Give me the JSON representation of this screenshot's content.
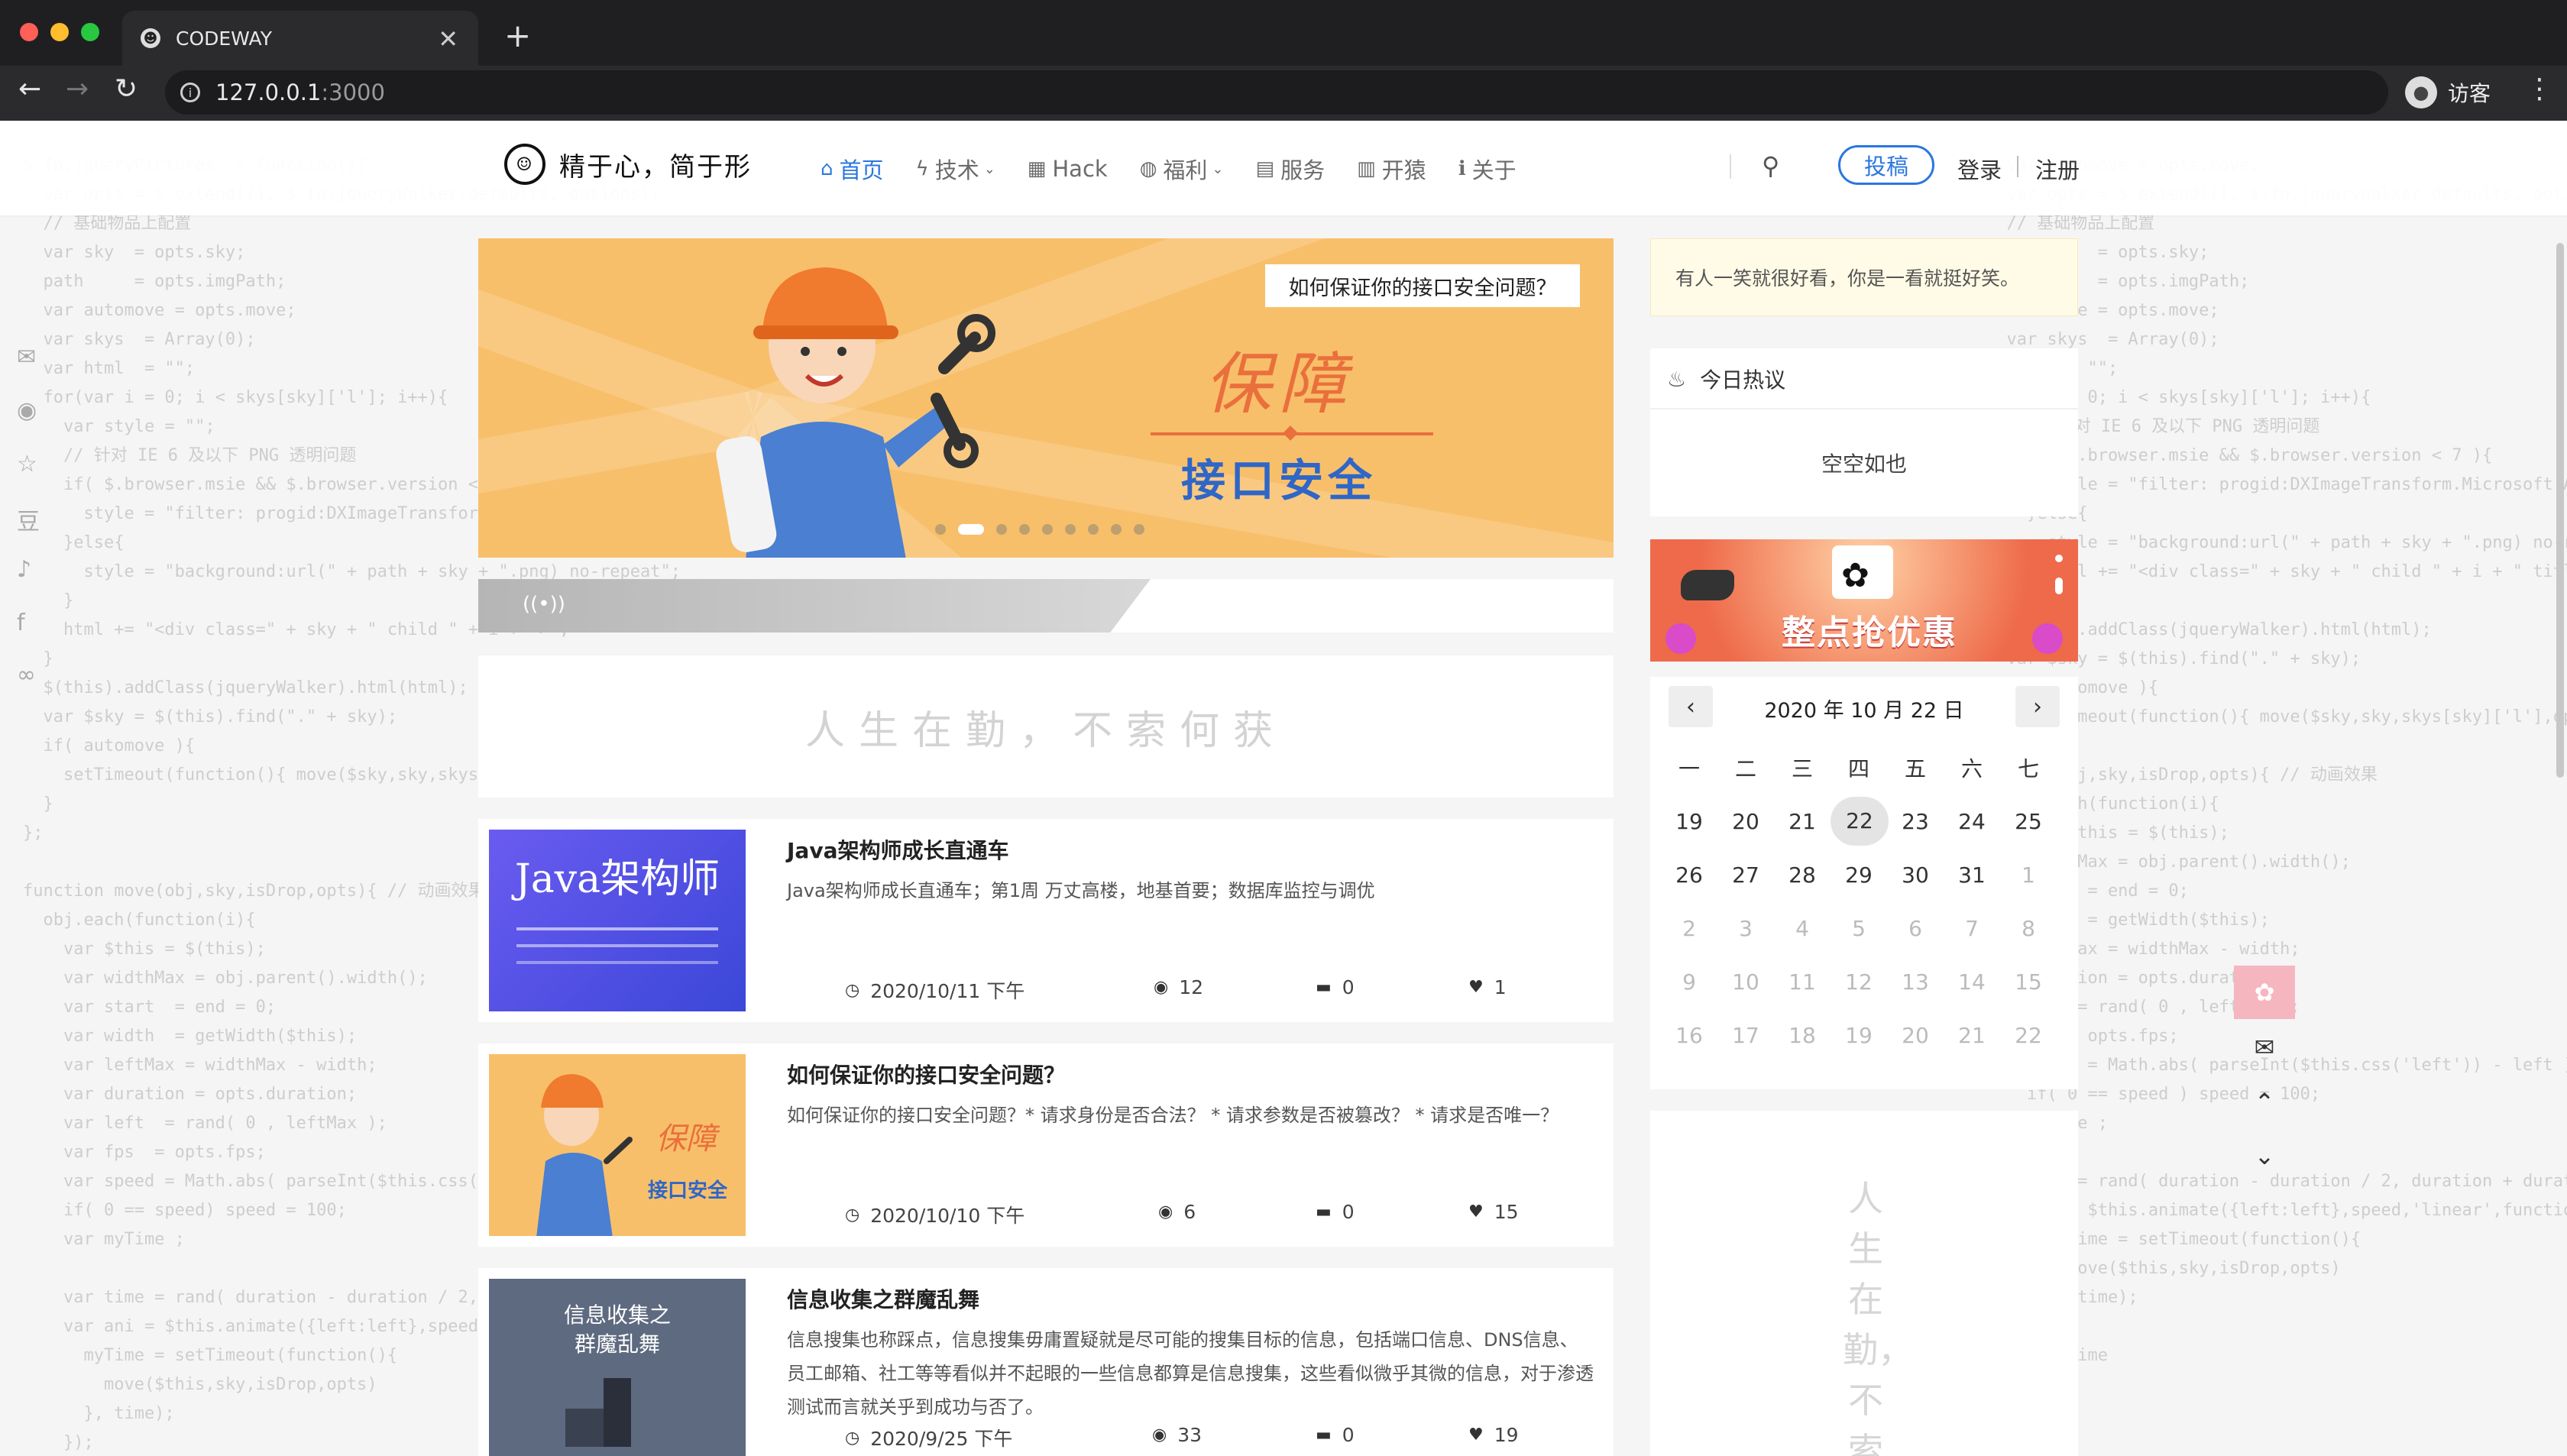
{
  "browser": {
    "tab_title": "CODEWAY",
    "favicon": "☻",
    "url_host": "127.0.0.1",
    "url_port": ":3000",
    "profile_label": "访客"
  },
  "site": {
    "logo_text": "精于心，简于形",
    "nav": [
      {
        "label": "首页",
        "icon": "home-icon",
        "glyph": "⌂",
        "active": true
      },
      {
        "label": "技术",
        "icon": "lightning-icon",
        "glyph": "ϟ",
        "dropdown": true
      },
      {
        "label": "Hack",
        "icon": "grid-icon",
        "glyph": "▦"
      },
      {
        "label": "福利",
        "icon": "basketball-icon",
        "glyph": "◍",
        "dropdown": true
      },
      {
        "label": "服务",
        "icon": "book-icon",
        "glyph": "▤"
      },
      {
        "label": "开猿",
        "icon": "columns-icon",
        "glyph": "▥"
      },
      {
        "label": "关于",
        "icon": "info-icon",
        "glyph": "ℹ"
      }
    ],
    "tougao": "投稿",
    "login": "登录",
    "register": "注册"
  },
  "banner": {
    "headline": "如何保证你的接口安全问题？",
    "big_text": "保障",
    "sub_text": "接口安全",
    "slides": 10,
    "active_slide": 2
  },
  "motto": "人生在勤，不索何获",
  "posts": [
    {
      "title": "Java架构师成长直通车",
      "desc": "Java架构师成长直通车；第1周 万丈高楼，地基首要；数据库监控与调优",
      "date": "2020/10/11 下午",
      "views": "12",
      "comments": "0",
      "likes": "1",
      "thumb_title": "Java架构师",
      "thumb_color": "#5a50e8"
    },
    {
      "title": "如何保证你的接口安全问题？",
      "desc": "如何保证你的接口安全问题？* 请求身份是否合法？ * 请求参数是否被篡改？ * 请求是否唯一？",
      "date": "2020/10/10 下午",
      "views": "6",
      "comments": "0",
      "likes": "15",
      "thumb_title": "保障",
      "thumb_sub": "接口安全",
      "thumb_color": "#f8bf6a"
    },
    {
      "title": "信息收集之群魔乱舞",
      "desc": "信息搜集也称踩点，信息搜集毋庸置疑就是尽可能的搜集目标的信息，包括端口信息、DNS信息、员工邮箱、社工等等看似并不起眼的一些信息都算是信息搜集，这些看似微乎其微的信息，对于渗透测试而言就关乎到成功与否了。",
      "date": "2020/9/25 下午",
      "views": "33",
      "comments": "0",
      "likes": "19",
      "thumb_title": "信息收集之",
      "thumb_sub": "群魔乱舞",
      "thumb_color": "#5e6a80"
    }
  ],
  "sidebar": {
    "quote": "有人一笑就很好看，你是一看就挺好笑。",
    "hot_title": "今日热议",
    "hot_empty": "空空如也",
    "ad_text": "整点抢优惠",
    "vertical_motto": "人生在勤，不索"
  },
  "calendar": {
    "title": "2020 年  10 月  22 日",
    "weekdays": [
      "一",
      "二",
      "三",
      "四",
      "五",
      "六",
      "七"
    ],
    "weeks": [
      [
        "19",
        "20",
        "21",
        "22",
        "23",
        "24",
        "25"
      ],
      [
        "26",
        "27",
        "28",
        "29",
        "30",
        "31",
        "1"
      ],
      [
        "2",
        "3",
        "4",
        "5",
        "6",
        "7",
        "8"
      ],
      [
        "9",
        "10",
        "11",
        "12",
        "13",
        "14",
        "15"
      ],
      [
        "16",
        "17",
        "18",
        "19",
        "20",
        "21",
        "22"
      ]
    ],
    "today": "22"
  },
  "colors": {
    "accent": "#2a77e0",
    "banner_bg": "#f8bf6a"
  }
}
